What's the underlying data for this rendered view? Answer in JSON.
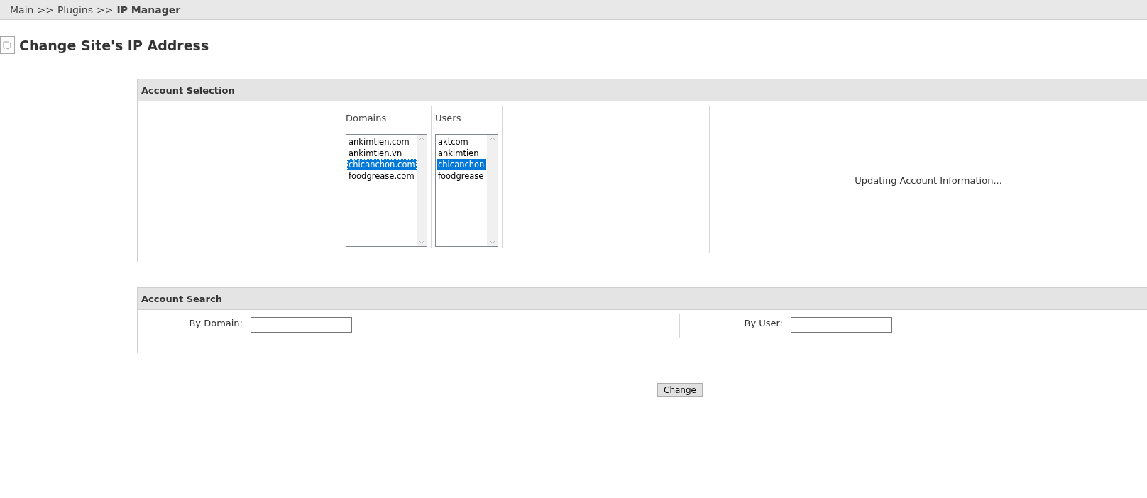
{
  "breadcrumb": {
    "items": [
      {
        "label": "Main",
        "current": false
      },
      {
        "label": "Plugins",
        "current": false
      },
      {
        "label": "IP Manager",
        "current": true
      }
    ],
    "separator": ">>"
  },
  "page": {
    "title": "Change Site's IP Address"
  },
  "account_selection": {
    "title": "Account Selection",
    "lists": [
      {
        "heading": "Domains",
        "options": [
          {
            "label": "ankimtien.com",
            "selected": false,
            "focused": false
          },
          {
            "label": "ankimtien.vn",
            "selected": false,
            "focused": false
          },
          {
            "label": "chicanchon.com",
            "selected": true,
            "focused": true
          },
          {
            "label": "foodgrease.com",
            "selected": false,
            "focused": false
          }
        ]
      },
      {
        "heading": "Users",
        "options": [
          {
            "label": "aktcom",
            "selected": false,
            "focused": false
          },
          {
            "label": "ankimtien",
            "selected": false,
            "focused": false
          },
          {
            "label": "chicanchon",
            "selected": true,
            "focused": false
          },
          {
            "label": "foodgrease",
            "selected": false,
            "focused": false
          }
        ]
      }
    ],
    "status": "Updating Account Information..."
  },
  "account_search": {
    "title": "Account Search",
    "fields": [
      {
        "label": "By Domain:"
      },
      {
        "label": "By User:"
      }
    ]
  },
  "buttons": [
    {
      "label": "Change"
    }
  ]
}
